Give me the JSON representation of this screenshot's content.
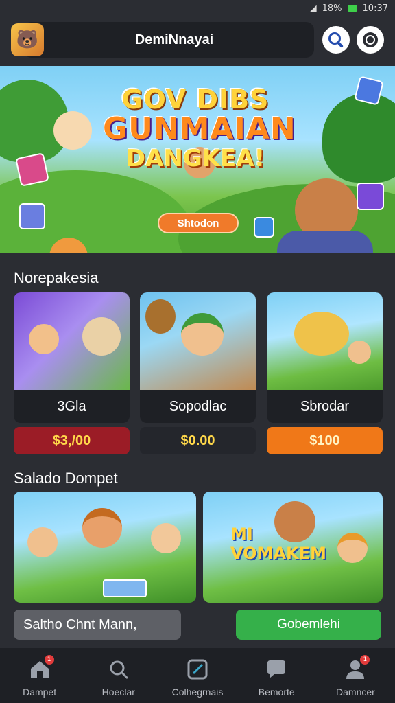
{
  "status_bar": {
    "signal_text": "%",
    "battery": "18%",
    "time": "10:37"
  },
  "header": {
    "title": "DemiNnayai"
  },
  "hero": {
    "line1": "GOV DIBS",
    "line2": "GUNMAIAN",
    "line3": "DANGKEA!",
    "badge": "Shtodon"
  },
  "section1": {
    "title": "Norepakesia",
    "cards": [
      {
        "label": "3Gla",
        "price": "$3,/00",
        "price_color": "#9b1c26"
      },
      {
        "label": "Sopodlac",
        "price": "$0.00",
        "price_color": "#2a2c33"
      },
      {
        "label": "Sbrodar",
        "price": "$100",
        "price_color": "#f07818"
      }
    ]
  },
  "section2": {
    "title": "Salado Dompet",
    "banner_text": "MI VOMAKEM",
    "input_value": "Saltho Chnt Mann,",
    "cta": "Gobemlehi"
  },
  "nav": {
    "items": [
      {
        "label": "Dampet",
        "icon": "home-icon",
        "badge": "1"
      },
      {
        "label": "Hoeclar",
        "icon": "search-icon",
        "badge": ""
      },
      {
        "label": "Colhegrnais",
        "icon": "edit-icon",
        "badge": ""
      },
      {
        "label": "Bemorte",
        "icon": "chat-icon",
        "badge": ""
      },
      {
        "label": "Damncer",
        "icon": "user-icon",
        "badge": "1"
      }
    ]
  },
  "colors": {
    "accent_green": "#35b04a",
    "background": "#2b2d33"
  }
}
